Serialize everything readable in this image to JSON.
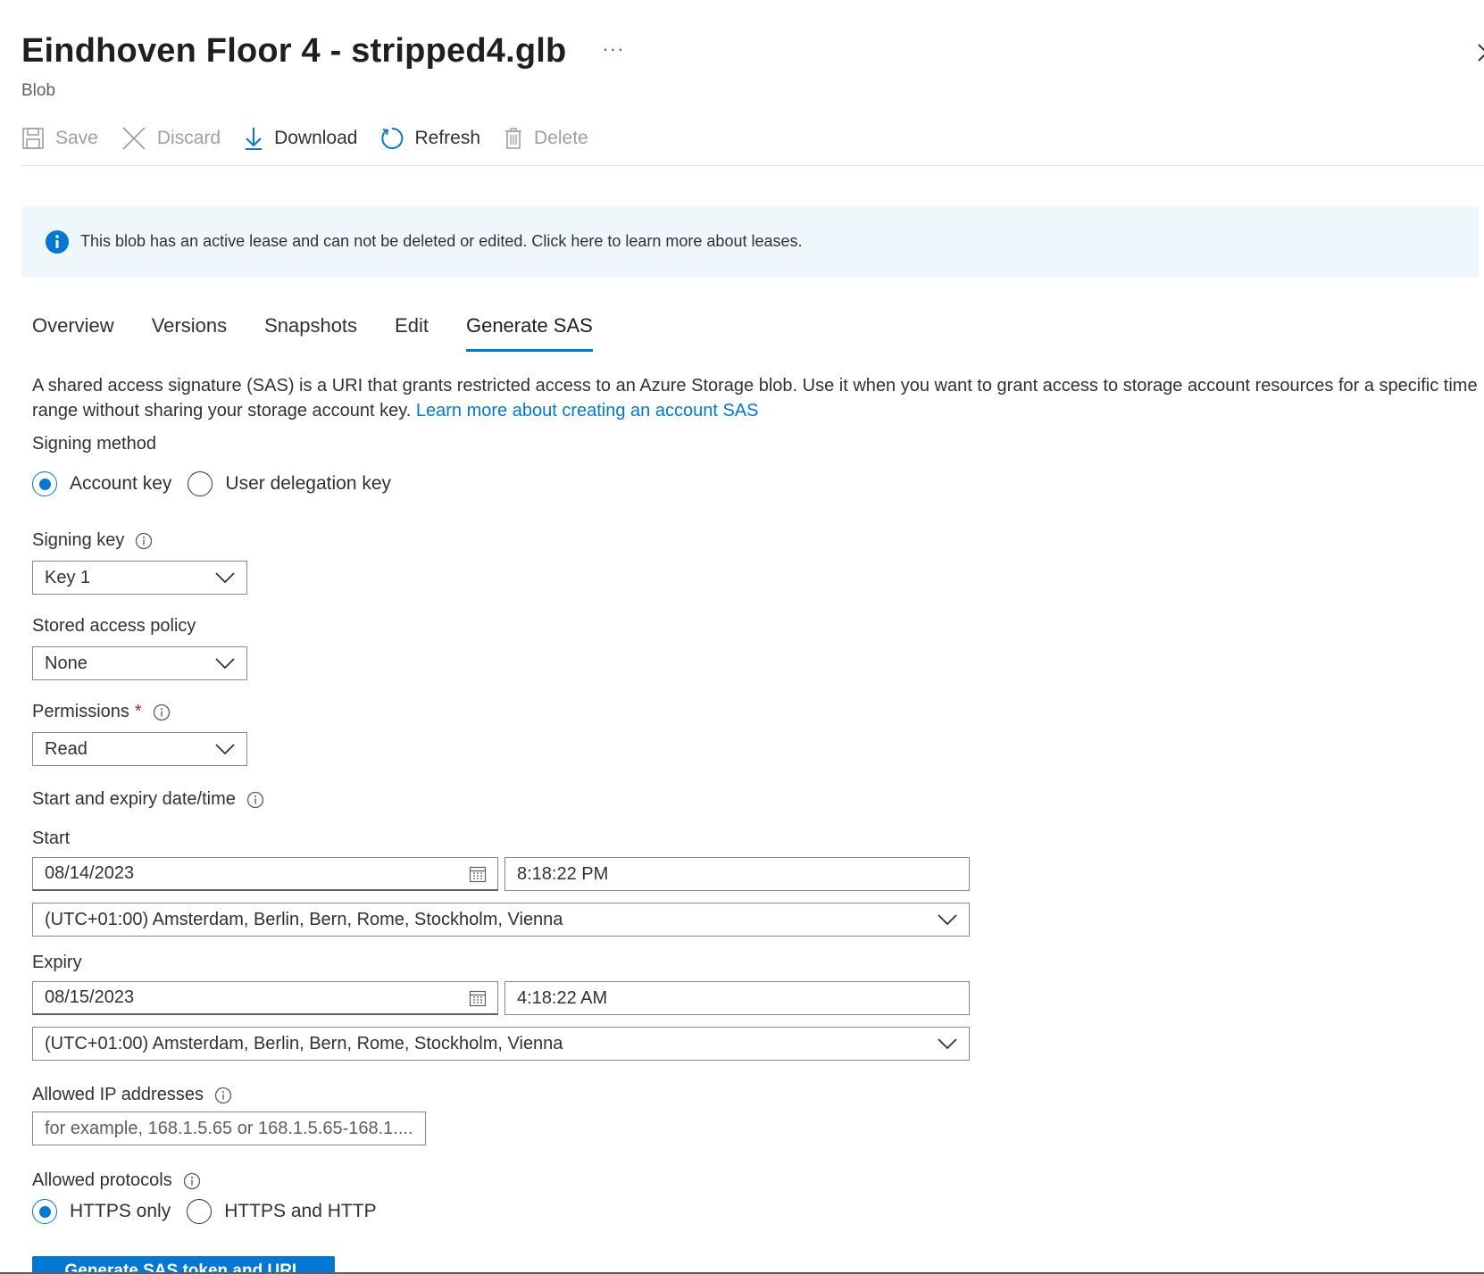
{
  "header": {
    "title": "Eindhoven Floor 4 - stripped4.glb",
    "more": "···",
    "subtitle": "Blob"
  },
  "toolbar": {
    "save": "Save",
    "discard": "Discard",
    "download": "Download",
    "refresh": "Refresh",
    "delete": "Delete"
  },
  "info_bar": {
    "text": "This blob has an active lease and can not be deleted or edited. Click here to learn more about leases."
  },
  "tabs": [
    "Overview",
    "Versions",
    "Snapshots",
    "Edit",
    "Generate SAS"
  ],
  "active_tab": "Generate SAS",
  "description": {
    "text": "A shared access signature (SAS) is a URI that grants restricted access to an Azure Storage blob. Use it when you want to grant access to storage account resources for a specific time range without sharing your storage account key.",
    "link": "Learn more about creating an account SAS"
  },
  "signing_method": {
    "label": "Signing method",
    "options": [
      "Account key",
      "User delegation key"
    ],
    "selected": "Account key"
  },
  "signing_key": {
    "label": "Signing key",
    "value": "Key 1"
  },
  "stored_access_policy": {
    "label": "Stored access policy",
    "value": "None"
  },
  "permissions": {
    "label": "Permissions",
    "required_mark": "*",
    "value": "Read"
  },
  "datetime": {
    "label": "Start and expiry date/time",
    "start": {
      "label": "Start",
      "date": "08/14/2023",
      "time": "8:18:22 PM",
      "timezone": "(UTC+01:00) Amsterdam, Berlin, Bern, Rome, Stockholm, Vienna"
    },
    "expiry": {
      "label": "Expiry",
      "date": "08/15/2023",
      "time": "4:18:22 AM",
      "timezone": "(UTC+01:00) Amsterdam, Berlin, Bern, Rome, Stockholm, Vienna"
    }
  },
  "allowed_ip": {
    "label": "Allowed IP addresses",
    "value": "",
    "placeholder": "for example, 168.1.5.65 or 168.1.5.65-168.1...."
  },
  "allowed_protocols": {
    "label": "Allowed protocols",
    "options": [
      "HTTPS only",
      "HTTPS and HTTP"
    ],
    "selected": "HTTPS only"
  },
  "generate_button": "Generate SAS token and URL",
  "colors": {
    "accent": "#0078d4",
    "info_bg": "#eff6fc",
    "required": "#a4262c",
    "disabled": "#a19f9d"
  }
}
